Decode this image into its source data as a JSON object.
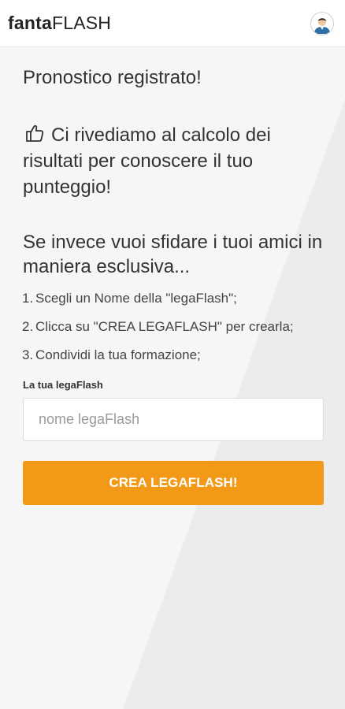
{
  "header": {
    "logo_bold": "fanta",
    "logo_light": "FLASH",
    "avatar_icon": "user-avatar-icon"
  },
  "main": {
    "registered_text": "Pronostico registrato!",
    "thumb_icon": "thumbs-up-icon",
    "thanks_text": "Ci rivediamo al calcolo dei risultati per conoscere il tuo punteggio!",
    "challenge_text": "Se invece vuoi sfidare i tuoi amici in maniera esclusiva...",
    "steps": [
      {
        "num": "1.",
        "text": "Scegli un Nome della \"legaFlash\";"
      },
      {
        "num": "2.",
        "text": "Clicca su \"CREA LEGAFLASH\" per crearla;"
      },
      {
        "num": "3.",
        "text": "Condividi la tua formazione;"
      }
    ],
    "field_label": "La tua legaFlash",
    "input_placeholder": "nome legaFlash",
    "input_value": "",
    "button_label": "CREA LEGAFLASH!"
  },
  "colors": {
    "accent": "#f29a17",
    "background": "#f6f6f6"
  }
}
